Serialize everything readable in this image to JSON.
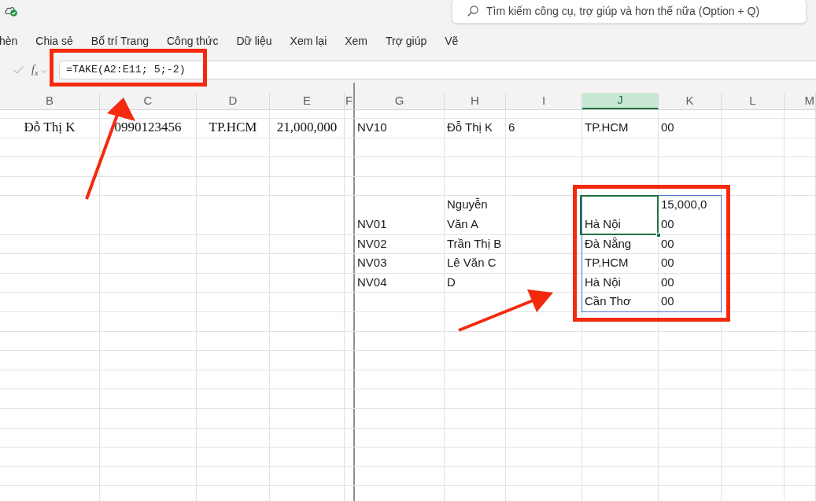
{
  "title_bar": {
    "search": {
      "placeholder": "Tìm kiếm công cụ, trợ giúp và hơn thế nữa (Option + Q)"
    }
  },
  "ribbon_tabs": [
    {
      "label": "hèn",
      "selected": false
    },
    {
      "label": "Chia sẻ",
      "selected": false
    },
    {
      "label": "Bố trí Trang",
      "selected": false
    },
    {
      "label": "Công thức",
      "selected": false
    },
    {
      "label": "Dữ liệu",
      "selected": false
    },
    {
      "label": "Xem lại",
      "selected": false
    },
    {
      "label": "Xem",
      "selected": false
    },
    {
      "label": "Trợ giúp",
      "selected": false
    },
    {
      "label": "Vẽ",
      "selected": false
    }
  ],
  "formula_bar": {
    "function_button": "f$_{x}$",
    "formula": "=TAKE(A2:E11; 5;-2)"
  },
  "sheet": {
    "columns": [
      {
        "label": "B",
        "selected": false
      },
      {
        "label": "C",
        "selected": false
      },
      {
        "label": "D",
        "selected": false
      },
      {
        "label": "E",
        "selected": false
      },
      {
        "label": "F",
        "selected": false
      },
      {
        "label": "G",
        "selected": false
      },
      {
        "label": "H",
        "selected": false
      },
      {
        "label": "I",
        "selected": false
      },
      {
        "label": "J",
        "selected": true
      },
      {
        "label": "K",
        "selected": false
      },
      {
        "label": "L",
        "selected": false
      },
      {
        "label": "M",
        "selected": false
      }
    ],
    "rows": [
      {
        "cells": [
          {
            "lines": [
              "Đỗ Thị K"
            ],
            "selected": false,
            "spill": false
          },
          {
            "lines": [
              "0990123456"
            ],
            "selected": false,
            "spill": false
          },
          {
            "lines": [
              "TP.HCM"
            ],
            "selected": false,
            "spill": false
          },
          {
            "lines": [
              "21,000,000"
            ],
            "selected": false,
            "spill": false
          },
          null,
          {
            "lines": [
              "NV10"
            ],
            "selected": false,
            "spill": false
          },
          {
            "lines": [
              "Đỗ Thị K"
            ],
            "selected": false,
            "spill": false
          },
          {
            "lines": [
              "6"
            ],
            "selected": false,
            "spill": false
          },
          {
            "lines": [
              "TP.HCM"
            ],
            "selected": false,
            "spill": false
          },
          {
            "lines": [
              "00"
            ],
            "selected": false,
            "spill": false
          },
          null,
          null
        ]
      },
      {
        "cells": [
          null,
          null,
          null,
          null,
          null,
          null,
          null,
          null,
          null,
          null,
          null,
          null
        ]
      },
      {
        "cells": [
          null,
          null,
          null,
          null,
          null,
          null,
          null,
          null,
          null,
          null,
          null,
          null
        ]
      },
      {
        "cells": [
          null,
          null,
          null,
          null,
          null,
          null,
          null,
          null,
          null,
          null,
          null,
          null
        ]
      },
      {
        "cells": [
          null,
          null,
          null,
          null,
          null,
          {
            "lines": [
              "NV01"
            ],
            "selected": false,
            "spill": false
          },
          {
            "lines": [
              "Nguyễn",
              "Văn A"
            ],
            "selected": false,
            "spill": false
          },
          null,
          {
            "lines": [
              "Hà Nội"
            ],
            "selected": true,
            "spill": true
          },
          {
            "lines": [
              "15,000,0",
              "00"
            ],
            "selected": false,
            "spill": true
          },
          null,
          null
        ]
      },
      {
        "cells": [
          null,
          null,
          null,
          null,
          null,
          {
            "lines": [
              "NV02"
            ],
            "selected": false,
            "spill": false
          },
          {
            "lines": [
              "Trần Thị B"
            ],
            "selected": false,
            "spill": false
          },
          null,
          {
            "lines": [
              "Đà Nẵng"
            ],
            "selected": false,
            "spill": true
          },
          {
            "lines": [
              "00"
            ],
            "selected": false,
            "spill": true
          },
          null,
          null
        ]
      },
      {
        "cells": [
          null,
          null,
          null,
          null,
          null,
          {
            "lines": [
              "NV03"
            ],
            "selected": false,
            "spill": false
          },
          {
            "lines": [
              "Lê Văn C"
            ],
            "selected": false,
            "spill": false
          },
          null,
          {
            "lines": [
              "TP.HCM"
            ],
            "selected": false,
            "spill": true
          },
          {
            "lines": [
              "00"
            ],
            "selected": false,
            "spill": true
          },
          null,
          null
        ]
      },
      {
        "cells": [
          null,
          null,
          null,
          null,
          null,
          {
            "lines": [
              "NV04"
            ],
            "selected": false,
            "spill": false
          },
          {
            "lines": [
              "D"
            ],
            "selected": false,
            "spill": false
          },
          null,
          {
            "lines": [
              "Hà Nội"
            ],
            "selected": false,
            "spill": true
          },
          {
            "lines": [
              "00"
            ],
            "selected": false,
            "spill": true
          },
          null,
          null
        ]
      },
      {
        "cells": [
          null,
          null,
          null,
          null,
          null,
          null,
          null,
          null,
          {
            "lines": [
              "Cần Thơ"
            ],
            "selected": false,
            "spill": true
          },
          {
            "lines": [
              "00"
            ],
            "selected": false,
            "spill": true
          },
          null,
          null
        ]
      }
    ]
  }
}
